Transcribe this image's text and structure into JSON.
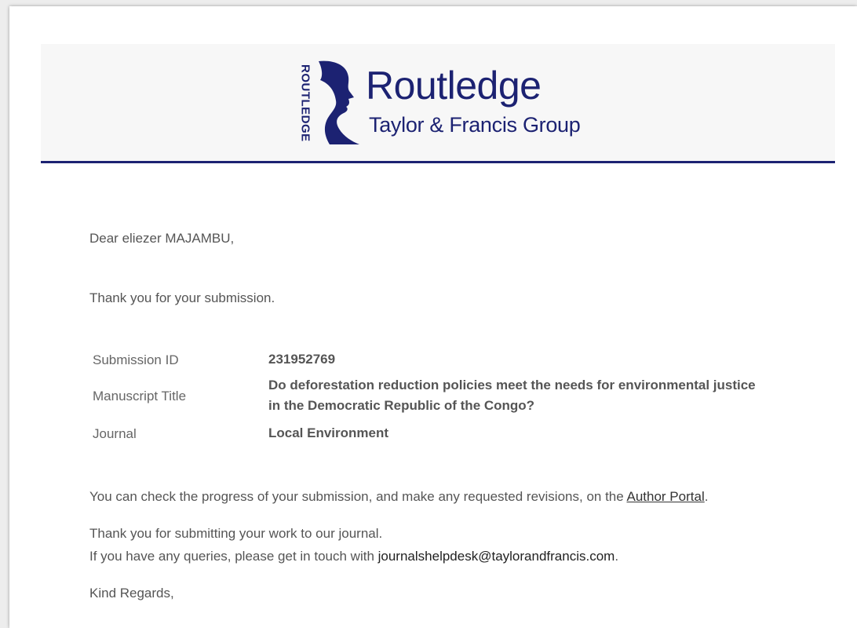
{
  "brand": {
    "vertical_text": "ROUTLEDGE",
    "name": "Routledge",
    "subtitle": "Taylor & Francis Group",
    "color": "#1c2272"
  },
  "email": {
    "greeting": "Dear eliezer MAJAMBU,",
    "thanks": "Thank you for your submission.",
    "details": [
      {
        "label": "Submission ID",
        "value": "231952769"
      },
      {
        "label": "Manuscript Title",
        "value": "Do deforestation reduction policies meet the needs for environmental justice in the Democratic Republic of the Congo?"
      },
      {
        "label": "Journal",
        "value": "Local Environment"
      }
    ],
    "progress_text": "You can check the progress of your submission, and make any requested revisions, on the ",
    "progress_link": "Author Portal",
    "progress_end": ".",
    "thanks_work": "Thank you for submitting your work to our journal.",
    "queries_text": "If you have any queries, please get in touch with ",
    "queries_email": "journalshelpdesk@taylorandfrancis.com",
    "queries_end": ".",
    "closing": "Kind Regards,"
  }
}
